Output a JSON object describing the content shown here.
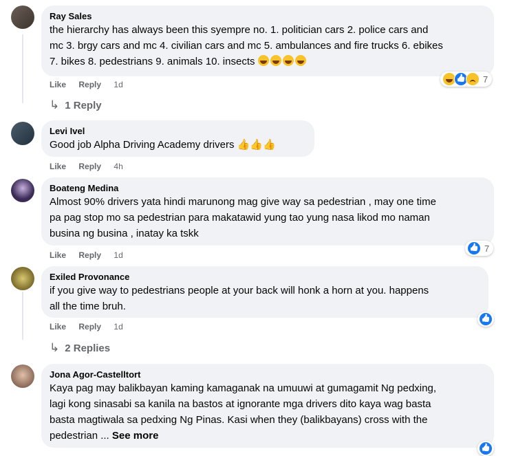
{
  "actions": {
    "like": "Like",
    "reply": "Reply"
  },
  "comments": [
    {
      "author": "Ray Sales",
      "lines": [
        "the hierarchy has always been this syempre no. 1. politician cars 2. police cars and",
        "mc 3. brgy cars and mc 4. civilian cars and mc 5. ambulances and fire trucks 6. ebikes",
        "7. bikes 8. pedestrians 9. animals 10. insects"
      ],
      "time": "1d",
      "reaction_count": "7",
      "replies_label": "1 Reply",
      "avatar_color": "#5a5048"
    },
    {
      "author": "Levi Ivel",
      "lines": [
        "Good job Alpha Driving Academy drivers"
      ],
      "time": "4h",
      "avatar_color": "#3b4a5a"
    },
    {
      "author": "Boateng Medina",
      "lines": [
        "Almost 90% drivers yata hindi marunong mag give way sa pedestrian , may one time",
        "pa pag stop mo sa pedestrian para makatawid yung tao yung nasa likod mo naman",
        "busina ng busina , inatay ka tskk"
      ],
      "time": "1d",
      "reaction_count": "7",
      "avatar_color": "#3a2a55"
    },
    {
      "author": "Exiled Provonance",
      "lines": [
        "if you give way to pedestrians people at your back will honk a horn at you. happens",
        "all the time bruh."
      ],
      "time": "1d",
      "replies_label": "2 Replies",
      "avatar_color": "#8a7a3a"
    },
    {
      "author": "Jona Agor-Castelltort",
      "lines": [
        "Kaya pag may balikbayan kaming kamaganak na umuuwi at gumagamit Ng pedxing,",
        "lagi kong sinasabi sa kanila na bastos at ignorante mga drivers dito kaya wag basta",
        "basta magtiwala sa pedxing Ng Pinas. Kasi when they (balikbayans) cross with the",
        "pedestrian ..."
      ],
      "see_more": "See more",
      "avatar_color": "#b08a70"
    }
  ],
  "colors": {
    "bubble": "#f0f2f5",
    "meta": "#65676b",
    "like_blue": "#1877f2"
  }
}
